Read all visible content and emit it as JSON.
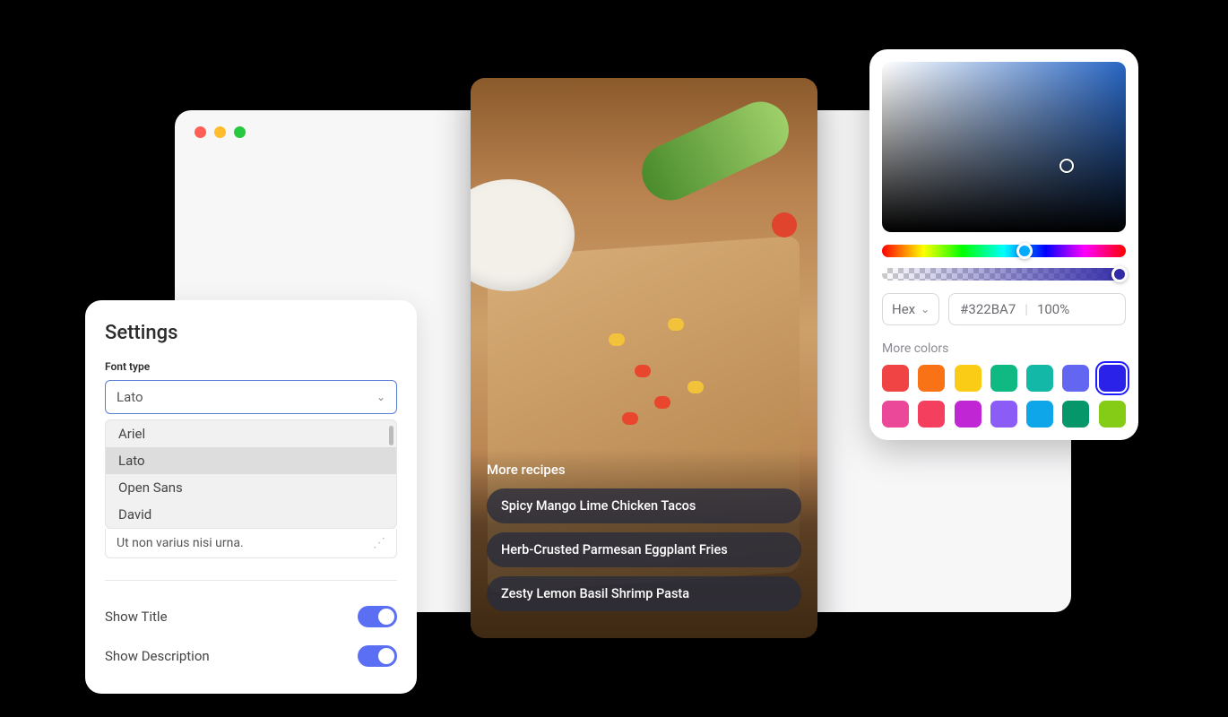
{
  "settings": {
    "title": "Settings",
    "font_type_label": "Font type",
    "font_selected": "Lato",
    "font_options": [
      "Ariel",
      "Lato",
      "Open Sans",
      "David"
    ],
    "sample_text": "Ut non varius nisi urna.",
    "toggles": [
      {
        "label": "Show Title",
        "on": true
      },
      {
        "label": "Show Description",
        "on": true
      }
    ]
  },
  "phone": {
    "section_title": "More recipes",
    "recipes": [
      "Spicy Mango Lime Chicken Tacos",
      "Herb-Crusted Parmesan Eggplant Fries",
      "Zesty Lemon Basil Shrimp Pasta"
    ]
  },
  "picker": {
    "format": "Hex",
    "hex": "#322BA7",
    "opacity": "100%",
    "more_colors_label": "More colors",
    "swatches": [
      "#f04343",
      "#f97316",
      "#facc15",
      "#10b981",
      "#14b8a6",
      "#6366f1",
      "#2a22e8",
      "#ec4899",
      "#f43f5e",
      "#c026d3",
      "#8b5cf6",
      "#0ea5e9",
      "#059669",
      "#84cc16"
    ],
    "selected_swatch_index": 6
  }
}
